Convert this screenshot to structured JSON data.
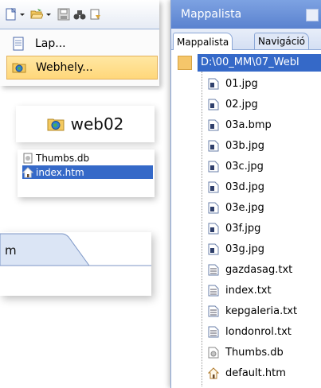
{
  "menu": {
    "items": [
      {
        "label": "Lap..."
      },
      {
        "label": "Webhely..."
      }
    ]
  },
  "web02": {
    "label": "web02"
  },
  "thumbs": {
    "rows": [
      {
        "label": "Thumbs.db"
      },
      {
        "label": "index.htm"
      }
    ]
  },
  "tab_fragment": {
    "label": "m"
  },
  "panel": {
    "title": "Mappalista",
    "tabs": [
      "Mappalista",
      "Navigáció"
    ],
    "root": "D:\\00_MM\\07_Webl",
    "files": [
      {
        "name": "01.jpg",
        "icon": "image-file-icon"
      },
      {
        "name": "02.jpg",
        "icon": "image-file-icon"
      },
      {
        "name": "03a.bmp",
        "icon": "image-file-icon"
      },
      {
        "name": "03b.jpg",
        "icon": "image-file-icon"
      },
      {
        "name": "03c.jpg",
        "icon": "image-file-icon"
      },
      {
        "name": "03d.jpg",
        "icon": "image-file-icon"
      },
      {
        "name": "03e.jpg",
        "icon": "image-file-icon"
      },
      {
        "name": "03f.jpg",
        "icon": "image-file-icon"
      },
      {
        "name": "03g.jpg",
        "icon": "image-file-icon"
      },
      {
        "name": "gazdasag.txt",
        "icon": "text-file-icon"
      },
      {
        "name": "index.txt",
        "icon": "text-file-icon"
      },
      {
        "name": "kepgaleria.txt",
        "icon": "text-file-icon"
      },
      {
        "name": "londonrol.txt",
        "icon": "text-file-icon"
      },
      {
        "name": "Thumbs.db",
        "icon": "db-file-icon"
      },
      {
        "name": "default.htm",
        "icon": "home-page-icon"
      }
    ]
  }
}
